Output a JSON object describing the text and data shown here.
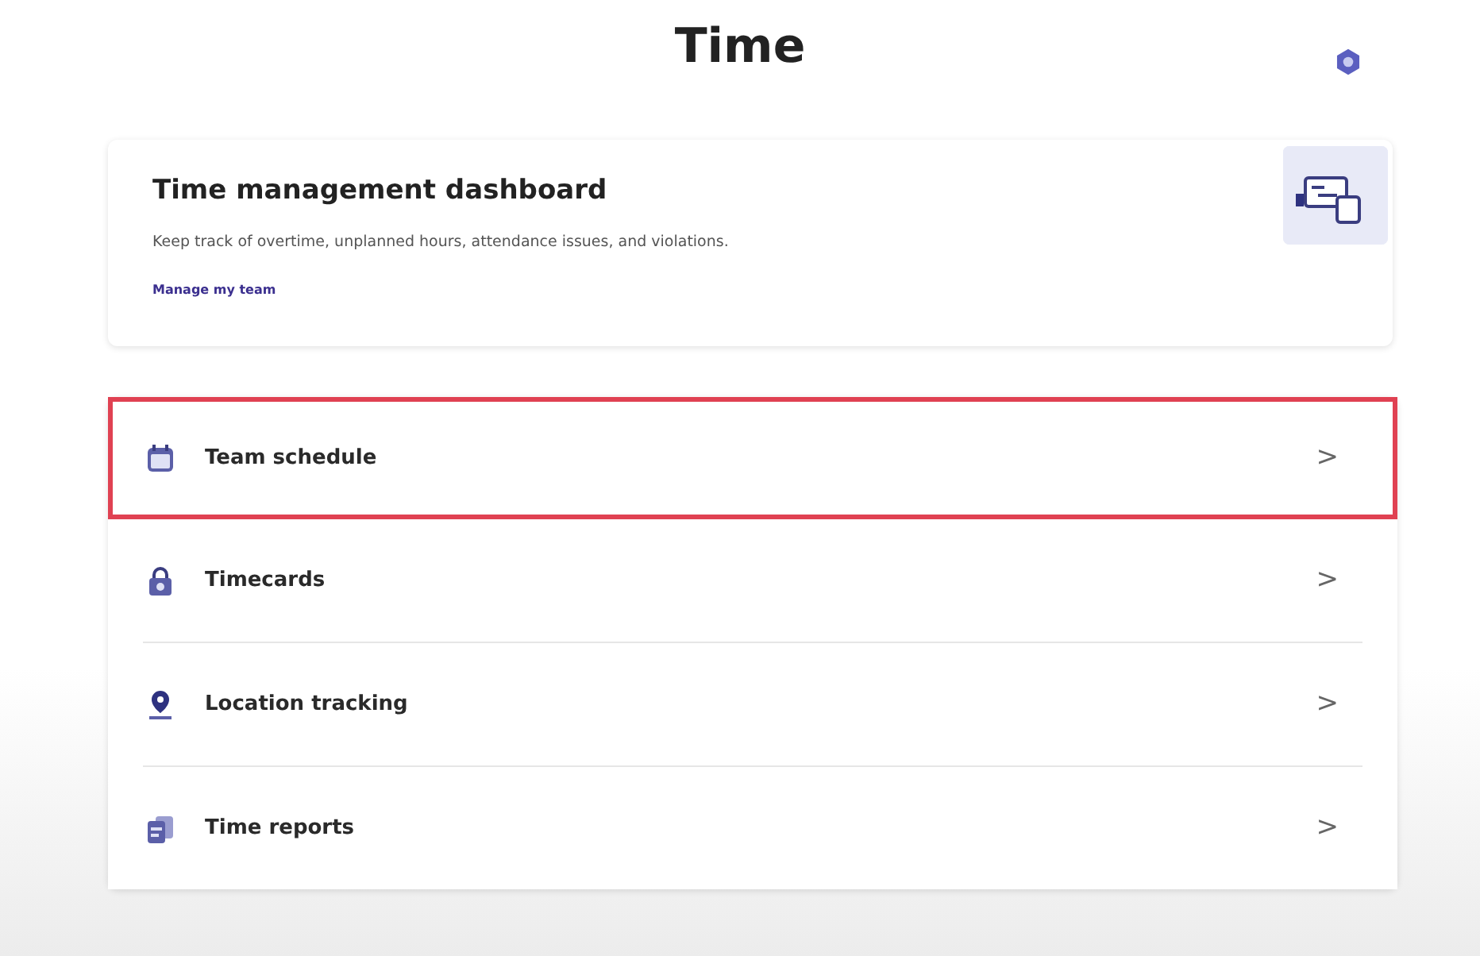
{
  "title": "Time",
  "dashboard": {
    "title": "Time management dashboard",
    "description": "Keep track of overtime, unplanned hours, attendance issues, and violations.",
    "link": "Manage my team"
  },
  "items": [
    {
      "label": "Team schedule",
      "kind": "calendar",
      "chevron": ">",
      "highlighted": true
    },
    {
      "label": "Timecards",
      "kind": "timecard",
      "chevron": ">",
      "highlighted": false
    },
    {
      "label": "Location tracking",
      "kind": "location",
      "chevron": ">",
      "highlighted": false
    },
    {
      "label": "Time reports",
      "kind": "reports",
      "chevron": ">",
      "highlighted": false
    }
  ]
}
